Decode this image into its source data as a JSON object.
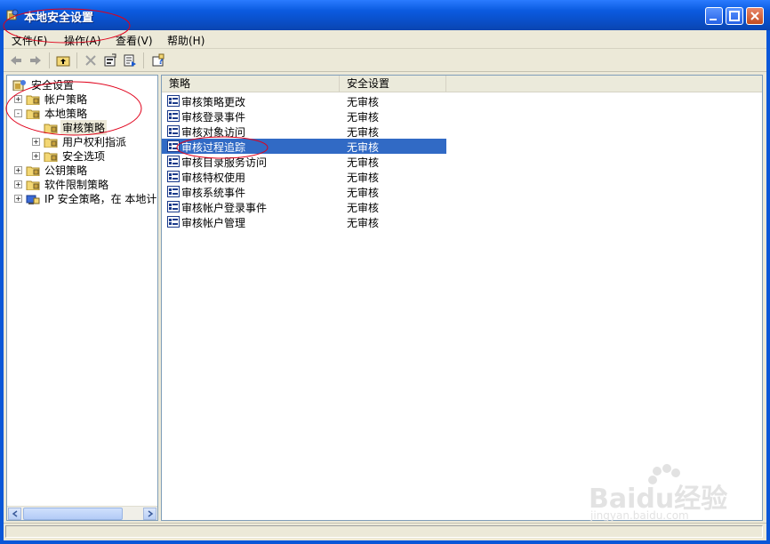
{
  "window": {
    "title": "本地安全设置",
    "title_icon": "local-security-icon"
  },
  "menu": [
    {
      "label": "文件(F)"
    },
    {
      "label": "操作(A)"
    },
    {
      "label": "查看(V)"
    },
    {
      "label": "帮助(H)"
    }
  ],
  "toolbar": {
    "back_icon": "back-arrow-icon",
    "forward_icon": "forward-arrow-icon",
    "up_icon": "up-folder-icon",
    "delete_icon": "delete-icon",
    "properties_icon": "properties-icon",
    "export_icon": "export-list-icon",
    "help_icon": "help-icon"
  },
  "tree": [
    {
      "label": "安全设置",
      "level": 0,
      "expander": "",
      "icon": "security-settings-icon"
    },
    {
      "label": "帐户策略",
      "level": 1,
      "expander": "+",
      "icon": "folder-icon"
    },
    {
      "label": "本地策略",
      "level": 1,
      "expander": "-",
      "icon": "folder-open-icon"
    },
    {
      "label": "审核策略",
      "level": 2,
      "expander": "",
      "icon": "folder-icon",
      "selected": true
    },
    {
      "label": "用户权利指派",
      "level": 2,
      "expander": "+",
      "icon": "folder-icon"
    },
    {
      "label": "安全选项",
      "level": 2,
      "expander": "+",
      "icon": "folder-icon"
    },
    {
      "label": "公钥策略",
      "level": 1,
      "expander": "+",
      "icon": "folder-icon"
    },
    {
      "label": "软件限制策略",
      "level": 1,
      "expander": "+",
      "icon": "folder-icon"
    },
    {
      "label": "IP 安全策略，在 本地计算机",
      "level": 1,
      "expander": "+",
      "icon": "ip-security-icon"
    }
  ],
  "list": {
    "columns": [
      "策略",
      "安全设置"
    ],
    "rows": [
      {
        "policy": "审核策略更改",
        "setting": "无审核"
      },
      {
        "policy": "审核登录事件",
        "setting": "无审核"
      },
      {
        "policy": "审核对象访问",
        "setting": "无审核"
      },
      {
        "policy": "审核过程追踪",
        "setting": "无审核",
        "selected": true
      },
      {
        "policy": "审核目录服务访问",
        "setting": "无审核"
      },
      {
        "policy": "审核特权使用",
        "setting": "无审核"
      },
      {
        "policy": "审核系统事件",
        "setting": "无审核"
      },
      {
        "policy": "审核帐户登录事件",
        "setting": "无审核"
      },
      {
        "policy": "审核帐户管理",
        "setting": "无审核"
      }
    ]
  },
  "watermark": {
    "text": "Baidu经验",
    "subtext": "jingyan.baidu.com"
  },
  "colors": {
    "selection": "#316ac5",
    "titlebar": "#0a5be0",
    "annotation": "#e0001a"
  }
}
